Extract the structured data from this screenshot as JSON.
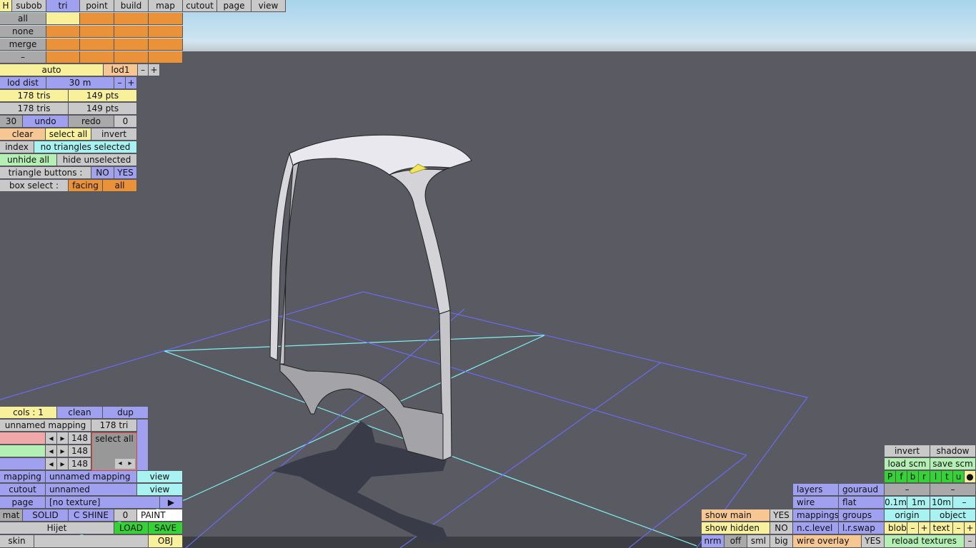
{
  "top_tabs": [
    "H",
    "subob",
    "tri",
    "point",
    "build",
    "map",
    "cutout",
    "page",
    "view"
  ],
  "sel_rows": [
    "all",
    "none",
    "merge",
    "–"
  ],
  "lod": {
    "mode": "auto",
    "level": "lod1",
    "minus": "–",
    "plus": "+",
    "dist_label": "lod dist",
    "dist_value": "30 m"
  },
  "stats": {
    "tris1": "178 tris",
    "pts1": "149 pts",
    "tris2": "178 tris",
    "pts2": "149 pts"
  },
  "undo": {
    "count": "30",
    "undo": "undo",
    "redo": "redo",
    "redo_count": "0"
  },
  "actions": {
    "clear": "clear",
    "select_all": "select all",
    "invert": "invert"
  },
  "index": {
    "label": "index",
    "status": "no triangles selected"
  },
  "hide": {
    "unhide": "unhide all",
    "hide_unselected": "hide unselected"
  },
  "tri_buttons": {
    "label": "triangle buttons :",
    "no": "NO",
    "yes": "YES"
  },
  "box_select": {
    "label": "box select :",
    "facing": "facing",
    "all": "all"
  },
  "colors": {
    "cols": "cols : 1",
    "clean": "clean",
    "dup": "dup",
    "map_name": "unnamed mapping",
    "map_tris": "178 tri",
    "r": "148",
    "g": "148",
    "b": "148",
    "select_all": "select all",
    "arrow_left": "◂",
    "arrow_right": "▸"
  },
  "mapping_panel": {
    "mapping_label": "mapping",
    "mapping_value": "unnamed mapping",
    "mapping_view": "view",
    "cutout_label": "cutout",
    "cutout_value": "unnamed",
    "cutout_view": "view",
    "page_label": "page",
    "page_value": "[no texture]",
    "page_arrow": "▶",
    "mat": "mat",
    "solid": "SOLID",
    "cshine": "C SHINE",
    "mat_num": "0",
    "paint": "PAINT",
    "name": "Hijet",
    "load": "LOAD",
    "save": "SAVE",
    "skin": "skin",
    "obj": "OBJ"
  },
  "display": {
    "show_main": "show main",
    "show_main_val": "YES",
    "show_hidden": "show hidden",
    "show_hidden_val": "NO",
    "nrm": "nrm",
    "off": "off",
    "sml": "sml",
    "big": "big",
    "layers": "layers",
    "gouraud": "gouraud",
    "wire": "wire",
    "flat": "flat",
    "mappings": "mappings",
    "groups": "groups",
    "nclevel": "n.c.level",
    "lrswap": "l.r.swap",
    "wire_overlay": "wire overlay",
    "wire_overlay_val": "YES"
  },
  "right_panel": {
    "invert": "invert",
    "shadow": "shadow",
    "load_scm": "load scm",
    "save_scm": "save scm",
    "views": [
      "P",
      "f",
      "b",
      "r",
      "l",
      "t",
      "u",
      "●"
    ],
    "dash1": "–",
    "dash2": "–",
    "step1": "0.1m",
    "step2": "1m",
    "step3": "10m",
    "step_minus": "–",
    "origin": "origin",
    "object": "object",
    "blob": "blob",
    "text": "text",
    "minus": "–",
    "plus": "+",
    "reload": "reload textures",
    "reload_minus": "–"
  }
}
